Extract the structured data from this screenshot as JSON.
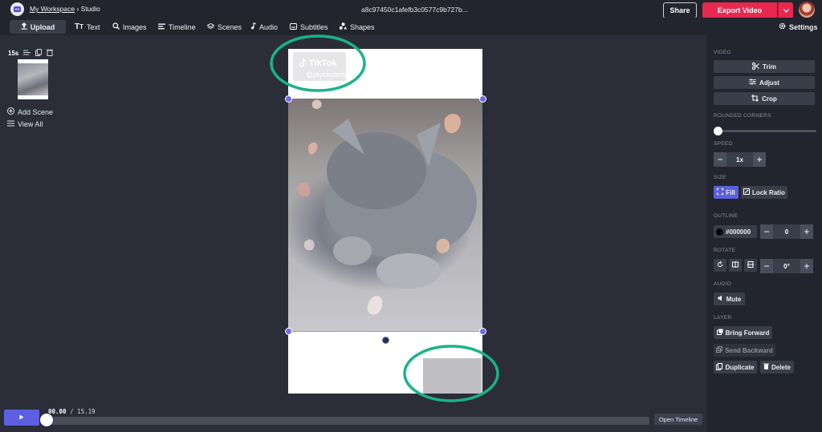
{
  "header": {
    "workspace": "My Workspace",
    "separator": "›",
    "section": "Studio",
    "project_id": "a8c97450c1afefb3c0577c9b727b...",
    "share_label": "Share",
    "export_label": "Export Video"
  },
  "toolbar": {
    "upload": "Upload",
    "text": "Text",
    "images": "Images",
    "timeline": "Timeline",
    "scenes": "Scenes",
    "audio": "Audio",
    "subtitles": "Subtitles",
    "shapes": "Shapes",
    "settings": "Settings"
  },
  "scenes": {
    "duration": "15s",
    "add_scene": "Add Scene",
    "view_all": "View All"
  },
  "canvas": {
    "tiktok_brand": "TikTok",
    "tiktok_handle": "@jaycinders"
  },
  "playback": {
    "current": "00.00",
    "separator": "/",
    "total": "15.19",
    "open_timeline": "Open Timeline"
  },
  "panel": {
    "video_heading": "VIDEO",
    "trim": "Trim",
    "adjust": "Adjust",
    "crop": "Crop",
    "rounded_heading": "ROUNDED CORNERS",
    "rounded_value": 0,
    "speed_heading": "SPEED",
    "speed_value": "1x",
    "size_heading": "SIZE",
    "fill": "Fill",
    "lock_ratio": "Lock Ratio",
    "outline_heading": "OUTLINE",
    "outline_color_label": "#000000",
    "outline_width": "0",
    "rotate_heading": "ROTATE",
    "rotate_value": "0°",
    "audio_heading": "AUDIO",
    "mute": "Mute",
    "layer_heading": "LAYER",
    "bring_forward": "Bring Forward",
    "send_backward": "Send Backward",
    "duplicate": "Duplicate",
    "delete": "Delete"
  },
  "colors": {
    "accent": "#5c5fe0",
    "export": "#e8294f",
    "highlight_circle": "#19b38a",
    "outline_color": "#000000"
  }
}
